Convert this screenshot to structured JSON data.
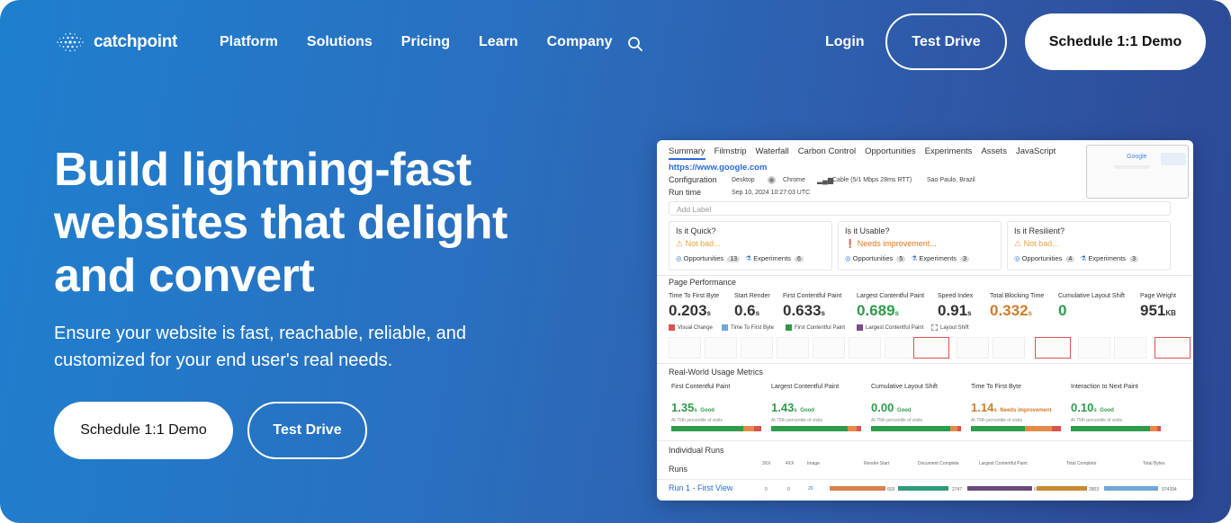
{
  "brand": {
    "name": "catchpoint"
  },
  "nav": {
    "links": [
      "Platform",
      "Solutions",
      "Pricing",
      "Learn",
      "Company"
    ],
    "login": "Login",
    "test_drive": "Test Drive",
    "schedule_demo": "Schedule 1:1 Demo"
  },
  "hero": {
    "headline_lines": [
      "Build lightning-fast",
      "websites that delight",
      "and convert"
    ],
    "subtitle": "Ensure your website is fast, reachable, reliable, and customized for your end user's real needs.",
    "cta_demo": "Schedule 1:1 Demo",
    "cta_test": "Test Drive"
  },
  "dashboard": {
    "tabs": [
      "Summary",
      "Filmstrip",
      "Waterfall",
      "Carbon Control",
      "Opportunities",
      "Experiments",
      "Assets",
      "JavaScript"
    ],
    "url": "https://www.google.com",
    "config_label": "Configuration",
    "config": {
      "device": "Desktop",
      "browser": "Chrome",
      "connection": "Cable (5/1 Mbps 28ms RTT)",
      "location": "Sao Paulo, Brazil"
    },
    "runtime_label": "Run time",
    "runtime": "Sep 10, 2024 10:27:03 UTC",
    "thumb_logo": "Google",
    "add_label_placeholder": "Add Label",
    "cards": [
      {
        "question": "Is it Quick?",
        "status": "Not bad...",
        "status_color": "#e6a23c",
        "opportunities": "13",
        "experiments": "6"
      },
      {
        "question": "Is it Usable?",
        "status": "Needs improvement...",
        "status_color": "#e0761f",
        "opportunities": "5",
        "experiments": "3"
      },
      {
        "question": "Is it Resilient?",
        "status": "Not bad...",
        "status_color": "#e6a23c",
        "opportunities": "4",
        "experiments": "3"
      }
    ],
    "opportunities_label": "Opportunities",
    "experiments_label": "Experiments",
    "page_perf_title": "Page Performance",
    "metrics": [
      {
        "label": "Time To First Byte",
        "value": "0.203",
        "unit": "s",
        "color": "#222"
      },
      {
        "label": "Start Render",
        "value": "0.6",
        "unit": "s",
        "color": "#222"
      },
      {
        "label": "First Contentful Paint",
        "value": "0.633",
        "unit": "s",
        "color": "#222"
      },
      {
        "label": "Largest Contentful Paint",
        "value": "0.689",
        "unit": "s",
        "color": "#2e9b4b"
      },
      {
        "label": "Speed Index",
        "value": "0.91",
        "unit": "s",
        "color": "#222"
      },
      {
        "label": "Total Blocking Time",
        "value": "0.332",
        "unit": "s",
        "color": "#d07b2a"
      },
      {
        "label": "Cumulative Layout Shift",
        "value": "0",
        "unit": "",
        "color": "#2e9b4b"
      },
      {
        "label": "Page Weight",
        "value": "951",
        "unit": "KB",
        "color": "#222"
      }
    ],
    "legend": [
      {
        "label": "Visual Change",
        "color": "#d9534f"
      },
      {
        "label": "Time To First Byte",
        "color": "#6fa8dc"
      },
      {
        "label": "First Contentful Paint",
        "color": "#2e9b4b"
      },
      {
        "label": "Largest Contentful Paint",
        "color": "#7b4a8c"
      },
      {
        "label": "Layout Shift",
        "color": "#ffffff"
      }
    ],
    "rw_title": "Real-World Usage Metrics",
    "rw_metrics": [
      {
        "label": "First Contentful Paint",
        "value": "1.35",
        "unit": "s",
        "status": "Good",
        "color": "#2e9b4b",
        "good": 0.8,
        "ni": 0.12,
        "poor": 0.08
      },
      {
        "label": "Largest Contentful Paint",
        "value": "1.43",
        "unit": "s",
        "status": "Good",
        "color": "#2e9b4b",
        "good": 0.85,
        "ni": 0.1,
        "poor": 0.05
      },
      {
        "label": "Cumulative Layout Shift",
        "value": "0.00",
        "unit": "",
        "status": "Good",
        "color": "#2e9b4b",
        "good": 0.88,
        "ni": 0.08,
        "poor": 0.04
      },
      {
        "label": "Time To First Byte",
        "value": "1.14",
        "unit": "s",
        "status": "Needs improvement",
        "color": "#d07b2a",
        "good": 0.6,
        "ni": 0.3,
        "poor": 0.1
      },
      {
        "label": "Interaction to Next Paint",
        "value": "0.10",
        "unit": "s",
        "status": "Good",
        "color": "#2e9b4b",
        "good": 0.88,
        "ni": 0.08,
        "poor": 0.04
      }
    ],
    "rw_note": "At 75th percentile of visits",
    "runs_title": "Individual Runs",
    "runs_label": "Runs",
    "runs_headers": [
      "3XX",
      "4XX",
      "Image",
      "Render Start",
      "Document Complete",
      "Largest Contentful Paint",
      "Total Complete",
      "Total Bytes"
    ],
    "run_name": "Run 1 - First View",
    "run_values": [
      "0",
      "0",
      "20",
      "603",
      "2747",
      "609",
      "2803",
      "974394"
    ]
  }
}
